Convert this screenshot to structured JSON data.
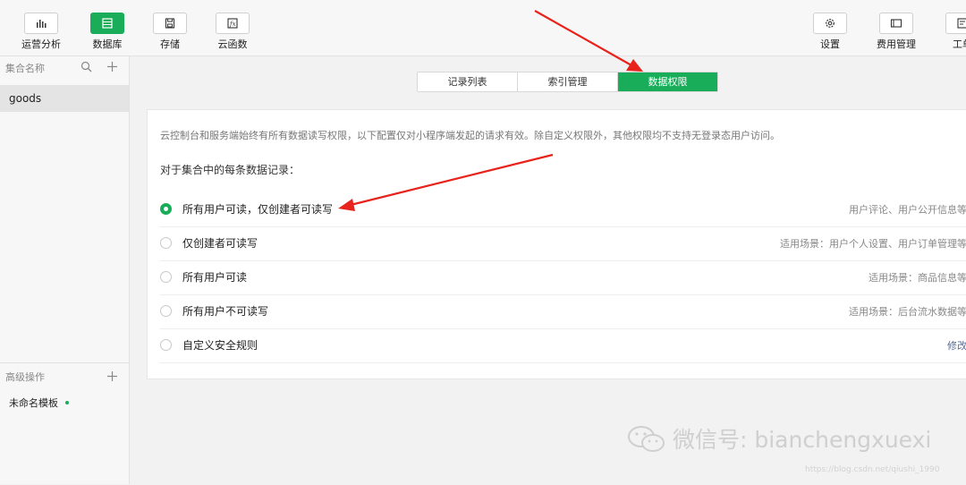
{
  "toolbar": {
    "left": [
      {
        "label": "运营分析",
        "icon": "bar-chart-icon"
      },
      {
        "label": "数据库",
        "icon": "database-icon",
        "active": true
      },
      {
        "label": "存储",
        "icon": "save-icon"
      },
      {
        "label": "云函数",
        "icon": "function-icon"
      }
    ],
    "right": [
      {
        "label": "设置",
        "icon": "gear-icon"
      },
      {
        "label": "费用管理",
        "icon": "wallet-icon"
      },
      {
        "label": "工单",
        "icon": "ticket-icon"
      }
    ]
  },
  "sidebar": {
    "header": "集合名称",
    "collections": [
      "goods"
    ],
    "advanced_header": "高级操作",
    "advanced_items": [
      "未命名模板"
    ]
  },
  "tabs": [
    {
      "label": "记录列表",
      "active": false
    },
    {
      "label": "索引管理",
      "active": false
    },
    {
      "label": "数据权限",
      "active": true
    }
  ],
  "permissions": {
    "description": "云控制台和服务端始终有所有数据读写权限，以下配置仅对小程序端发起的请求有效。除自定义权限外，其他权限均不支持无登录态用户访问。",
    "subtitle": "对于集合中的每条数据记录：",
    "options": [
      {
        "label": "所有用户可读，仅创建者可读写",
        "hint": "用户评论、用户公开信息等",
        "selected": true
      },
      {
        "label": "仅创建者可读写",
        "hint": "适用场景：用户个人设置、用户订单管理等",
        "selected": false
      },
      {
        "label": "所有用户可读",
        "hint": "适用场景：商品信息等",
        "selected": false
      },
      {
        "label": "所有用户不可读写",
        "hint": "适用场景：后台流水数据等",
        "selected": false
      },
      {
        "label": "自定义安全规则",
        "hint": "修改",
        "selected": false
      }
    ]
  },
  "watermark": {
    "text": "微信号: bianchengxuexi",
    "url": "https://blog.csdn.net/qiushi_1990"
  },
  "colors": {
    "accent": "#19ad5a",
    "arrow": "#e8231c",
    "link": "#576b95"
  }
}
